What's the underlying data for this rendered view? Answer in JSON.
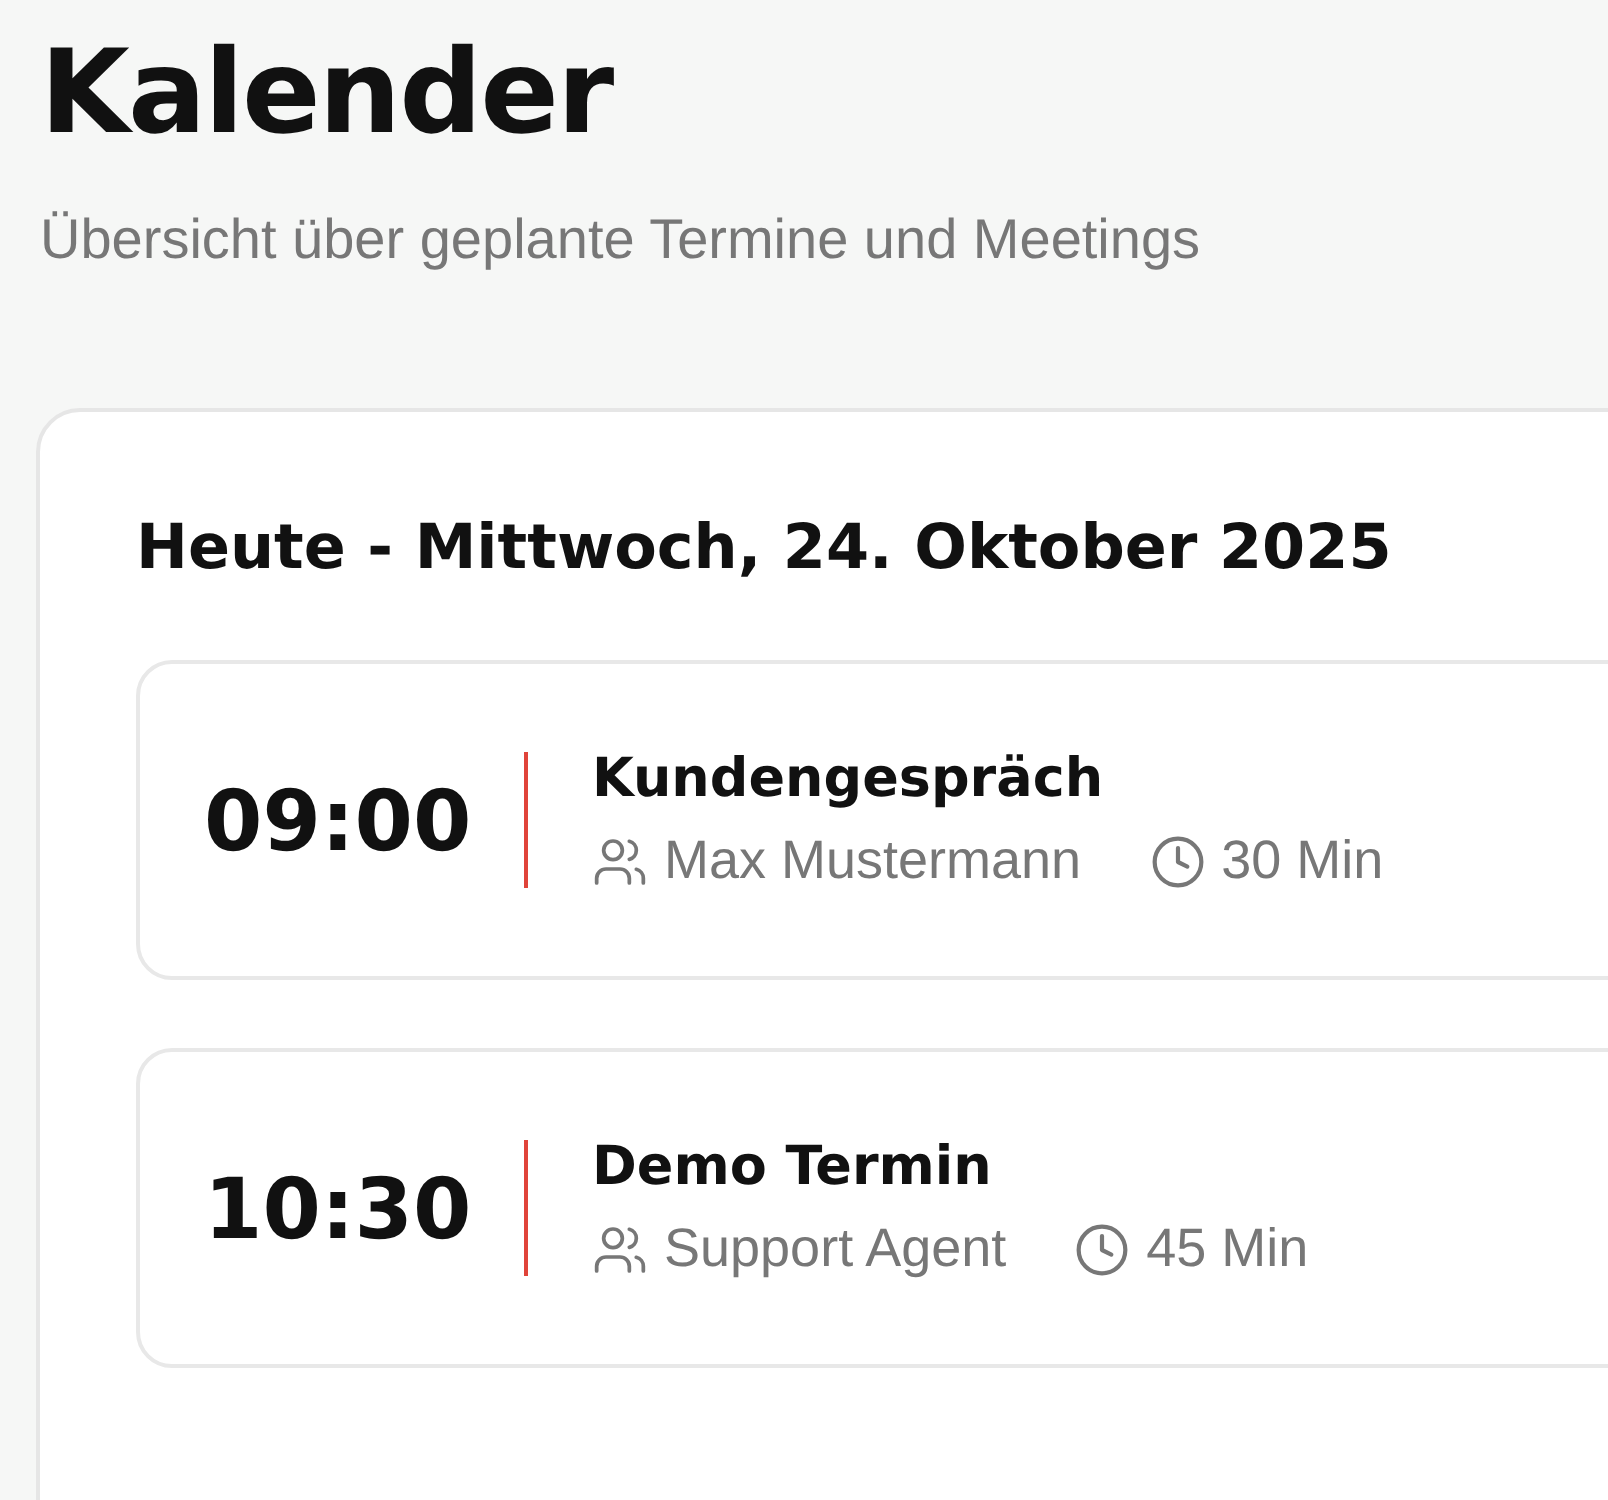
{
  "page": {
    "title": "Kalender",
    "subtitle": "Übersicht über geplante Termine und Meetings"
  },
  "today": {
    "heading": "Heute - Mittwoch, 24. Oktober 2025",
    "events": [
      {
        "time": "09:00",
        "title": "Kundengespräch",
        "person": "Max Mustermann",
        "duration": "30 Min"
      },
      {
        "time": "10:30",
        "title": "Demo Termin",
        "person": "Support Agent",
        "duration": "45 Min"
      }
    ]
  }
}
